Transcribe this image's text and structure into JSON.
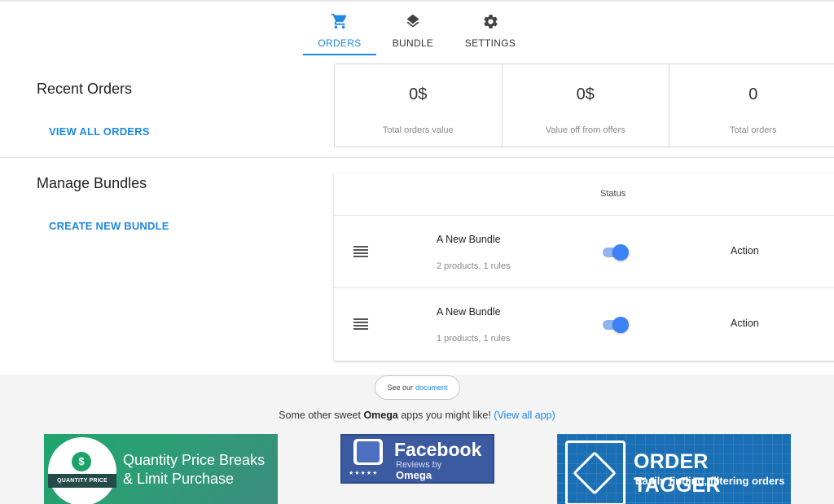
{
  "tabs": [
    {
      "label": "ORDERS",
      "icon": "cart-icon",
      "active": true
    },
    {
      "label": "BUNDLE",
      "icon": "layers-icon",
      "active": false
    },
    {
      "label": "SETTINGS",
      "icon": "gear-icon",
      "active": false
    }
  ],
  "recent_orders": {
    "title": "Recent Orders",
    "link": "VIEW ALL ORDERS",
    "stats": [
      {
        "value": "0$",
        "caption": "Total orders value"
      },
      {
        "value": "0$",
        "caption": "Value off from offers"
      },
      {
        "value": "0",
        "caption": "Total orders"
      }
    ]
  },
  "bundles": {
    "title": "Manage Bundles",
    "link": "CREATE NEW BUNDLE",
    "status_header": "Status",
    "rows": [
      {
        "name": "A New Bundle",
        "details": "2 products, 1 rules",
        "enabled": true,
        "action": "Action"
      },
      {
        "name": "A New Bundle",
        "details": "1 products, 1 rules",
        "enabled": true,
        "action": "Action"
      }
    ]
  },
  "footer": {
    "doc_prefix": "See our",
    "doc_link": "document",
    "promo_prefix": "Some other sweet",
    "promo_brand": "Omega",
    "promo_suffix": "apps you might like!",
    "promo_link": "(View all app)",
    "apps": [
      {
        "title_line1": "Quantity Price Breaks",
        "title_line2": "& Limit Purchase",
        "badge": "QUANTITY PRICE",
        "badge_symbol": "$"
      },
      {
        "title": "Facebook",
        "subtitle": "Reviews by",
        "brand": "Omega",
        "stars": "★★★★★"
      },
      {
        "title": "ORDER TAGGER",
        "subtitle": "Easily finding, filtering orders"
      }
    ]
  },
  "colors": {
    "accent": "#1e88e5",
    "toggle_on": "#3b82f6"
  }
}
